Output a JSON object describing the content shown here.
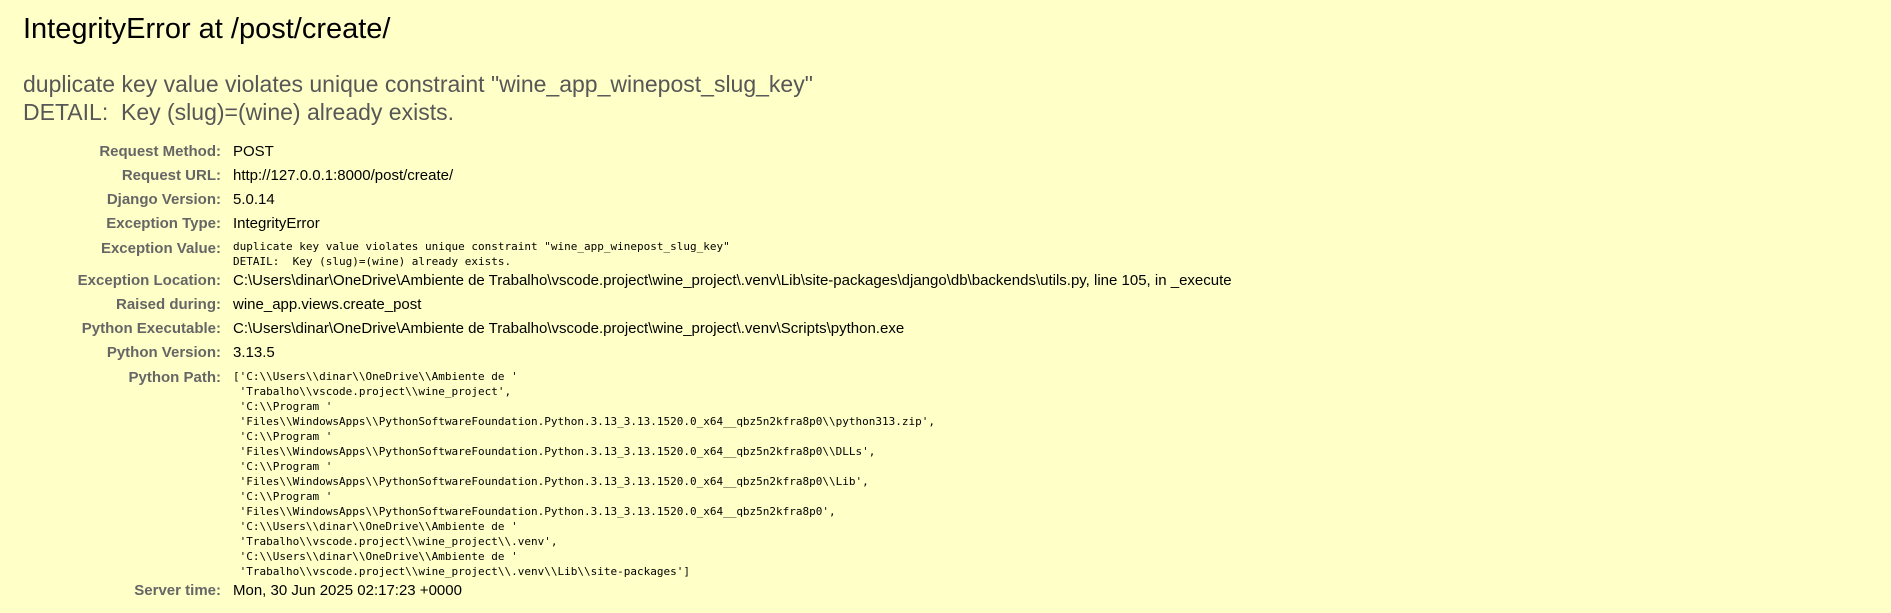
{
  "page": {
    "title": "IntegrityError at /post/create/",
    "exception_message": "duplicate key value violates unique constraint \"wine_app_winepost_slug_key\"\nDETAIL:  Key (slug)=(wine) already exists."
  },
  "meta": {
    "request_method": {
      "label": "Request Method:",
      "value": "POST"
    },
    "request_url": {
      "label": "Request URL:",
      "value": "http://127.0.0.1:8000/post/create/"
    },
    "django_version": {
      "label": "Django Version:",
      "value": "5.0.14"
    },
    "exception_type": {
      "label": "Exception Type:",
      "value": "IntegrityError"
    },
    "exception_value": {
      "label": "Exception Value:",
      "value": "duplicate key value violates unique constraint \"wine_app_winepost_slug_key\"\nDETAIL:  Key (slug)=(wine) already exists."
    },
    "exception_location": {
      "label": "Exception Location:",
      "value": "C:\\Users\\dinar\\OneDrive\\Ambiente de Trabalho\\vscode.project\\wine_project\\.venv\\Lib\\site-packages\\django\\db\\backends\\utils.py, line 105, in _execute"
    },
    "raised_during": {
      "label": "Raised during:",
      "value": "wine_app.views.create_post"
    },
    "python_executable": {
      "label": "Python Executable:",
      "value": "C:\\Users\\dinar\\OneDrive\\Ambiente de Trabalho\\vscode.project\\wine_project\\.venv\\Scripts\\python.exe"
    },
    "python_version": {
      "label": "Python Version:",
      "value": "3.13.5"
    },
    "python_path": {
      "label": "Python Path:",
      "value": "['C:\\\\Users\\\\dinar\\\\OneDrive\\\\Ambiente de '\n 'Trabalho\\\\vscode.project\\\\wine_project',\n 'C:\\\\Program '\n 'Files\\\\WindowsApps\\\\PythonSoftwareFoundation.Python.3.13_3.13.1520.0_x64__qbz5n2kfra8p0\\\\python313.zip',\n 'C:\\\\Program '\n 'Files\\\\WindowsApps\\\\PythonSoftwareFoundation.Python.3.13_3.13.1520.0_x64__qbz5n2kfra8p0\\\\DLLs',\n 'C:\\\\Program '\n 'Files\\\\WindowsApps\\\\PythonSoftwareFoundation.Python.3.13_3.13.1520.0_x64__qbz5n2kfra8p0\\\\Lib',\n 'C:\\\\Program '\n 'Files\\\\WindowsApps\\\\PythonSoftwareFoundation.Python.3.13_3.13.1520.0_x64__qbz5n2kfra8p0',\n 'C:\\\\Users\\\\dinar\\\\OneDrive\\\\Ambiente de '\n 'Trabalho\\\\vscode.project\\\\wine_project\\\\.venv',\n 'C:\\\\Users\\\\dinar\\\\OneDrive\\\\Ambiente de '\n 'Trabalho\\\\vscode.project\\\\wine_project\\\\.venv\\\\Lib\\\\site-packages']"
    },
    "server_time": {
      "label": "Server time:",
      "value": "Mon, 30 Jun 2025 02:17:23 +0000"
    }
  }
}
